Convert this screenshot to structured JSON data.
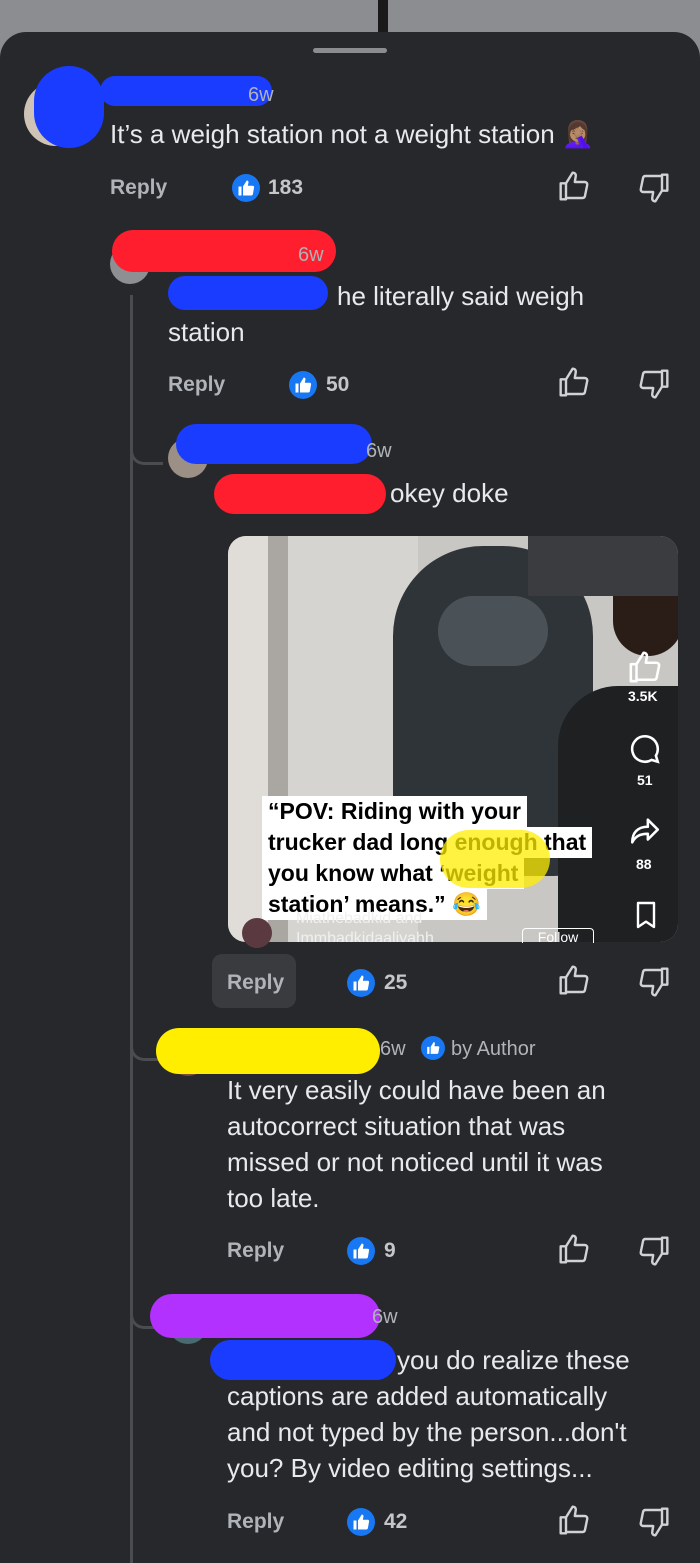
{
  "comments": [
    {
      "time": "6w",
      "text": "It’s a weigh station not a weight station 🤦🏽‍♀️",
      "reply_label": "Reply",
      "likes": "183"
    },
    {
      "time": "6w",
      "text_line1": "he literally said weigh",
      "text_line2": "station",
      "reply_label": "Reply",
      "likes": "50"
    },
    {
      "time": "6w",
      "text": "okey doke",
      "reply_label": "Reply",
      "likes": "25"
    },
    {
      "time": "6w",
      "author_badge": "by Author",
      "text_lines": [
        "It very easily could have been an",
        "autocorrect situation that was",
        "missed or not noticed until it was",
        "too late."
      ],
      "reply_label": "Reply",
      "likes": "9"
    },
    {
      "time": "6w",
      "text_lines": [
        "you do realize these",
        "captions are added automatically",
        "and not typed by the person...don't",
        "you? By video editing settings..."
      ],
      "reply_label": "Reply",
      "likes": "42"
    }
  ],
  "video": {
    "caption_lines": [
      "“POV: Riding with your",
      "trucker dad long enough that",
      "you know what ‘weight",
      "station’ means.” 😂"
    ],
    "likes": "3.5K",
    "comments": "51",
    "shares": "88",
    "account_line1": "Miathebadkid and",
    "account_line2": "Immbadkidaaliyahh",
    "follow_label": "Follow"
  },
  "colors": {
    "like_blue": "#1877f2",
    "sheet": "#26282b"
  }
}
